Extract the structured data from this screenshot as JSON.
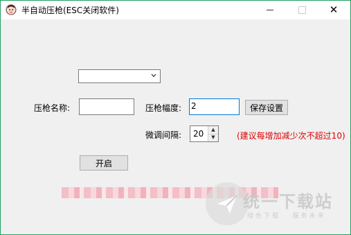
{
  "window": {
    "title": "半自动压枪(ESC关闭软件)",
    "close_glyph": "✕"
  },
  "form": {
    "combo_value": "",
    "name_label": "压枪名称:",
    "name_value": "",
    "range_label": "压枪幅度:",
    "range_value": "2",
    "save_button": "保存设置",
    "interval_label": "微调间隔:",
    "interval_value": "20",
    "hint": "(建议每增加减少次不超过10)",
    "start_button": "开启"
  },
  "watermark": {
    "text": "统一下载站",
    "sub": "绿色下载 . 服务未来"
  },
  "colors": {
    "accent_border": "#1f9f5f",
    "focus_border": "#0078d7",
    "hint_red": "#e00000"
  }
}
